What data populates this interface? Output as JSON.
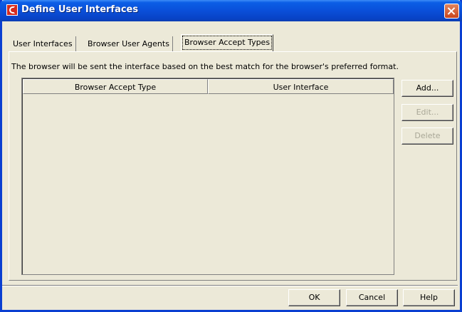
{
  "window": {
    "title": "Define User Interfaces"
  },
  "tabs": [
    {
      "label": "User Interfaces",
      "selected": false
    },
    {
      "label": "Browser User Agents",
      "selected": false
    },
    {
      "label": "Browser Accept Types",
      "selected": true
    }
  ],
  "description": "The browser will be sent the interface based on the best match for the browser's preferred format.",
  "table": {
    "columns": [
      "Browser Accept Type",
      "User Interface"
    ],
    "rows": []
  },
  "side_buttons": {
    "add": "Add...",
    "edit": "Edit...",
    "delete": "Delete"
  },
  "footer_buttons": {
    "ok": "OK",
    "cancel": "Cancel",
    "help": "Help"
  },
  "colors": {
    "titlebar": "#0a4fd9",
    "dialog_background": "#ece9d8",
    "close_button": "#c9451c",
    "disabled_text": "#a9a797"
  }
}
